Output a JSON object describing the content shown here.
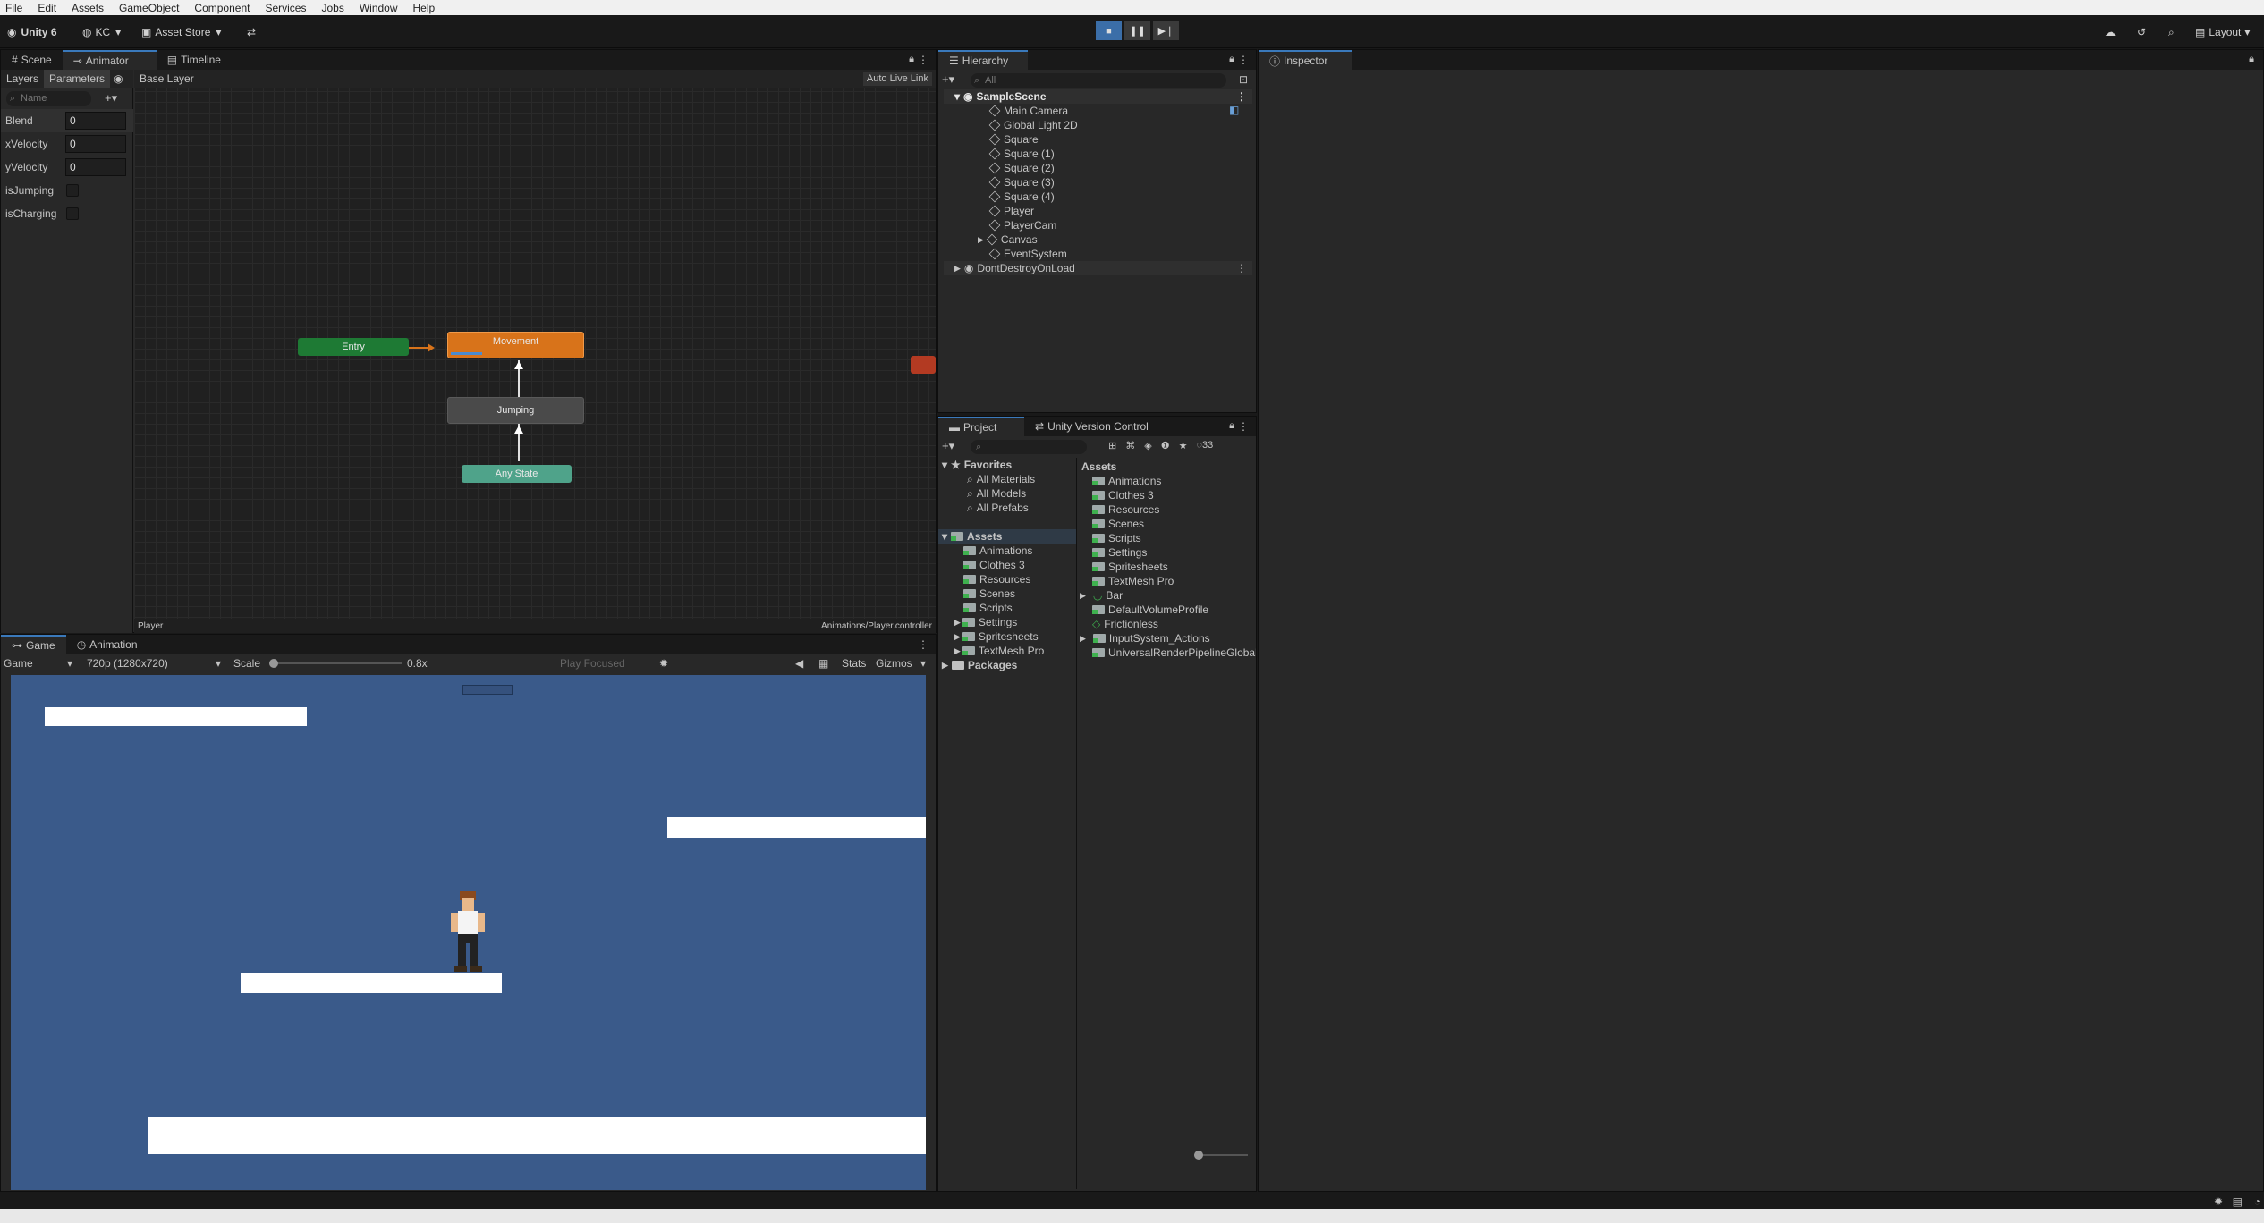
{
  "menu": [
    "File",
    "Edit",
    "Assets",
    "GameObject",
    "Component",
    "Services",
    "Jobs",
    "Window",
    "Help"
  ],
  "toolbar": {
    "unity": "Unity 6",
    "account": "KC",
    "asset_store": "Asset Store",
    "layout": "Layout"
  },
  "scene_tabs": {
    "scene": "Scene",
    "animator": "Animator",
    "timeline": "Timeline"
  },
  "animator": {
    "layers_tab": "Layers",
    "parameters_tab": "Parameters",
    "base_layer": "Base Layer",
    "auto_live_link": "Auto Live Link",
    "search_placeholder": "Name",
    "parameters": [
      {
        "name": "Blend",
        "value": "0"
      },
      {
        "name": "xVelocity",
        "value": "0"
      },
      {
        "name": "yVelocity",
        "value": "0"
      },
      {
        "name": "isJumping"
      },
      {
        "name": "isCharging"
      }
    ],
    "states": {
      "entry": "Entry",
      "movement": "Movement",
      "jumping": "Jumping",
      "any_state": "Any State"
    },
    "footer_left": "Player",
    "footer_right": "Animations/Player.controller"
  },
  "game_tabs": {
    "game": "Game",
    "animation": "Animation"
  },
  "game_bar": {
    "display": "Game",
    "resolution": "720p (1280x720)",
    "scale_label": "Scale",
    "scale_value": "0.8x",
    "play_focused": "Play Focused",
    "stats": "Stats",
    "gizmos": "Gizmos"
  },
  "game_view": {
    "background": "#3a5a8a"
  },
  "hierarchy": {
    "tab": "Hierarchy",
    "search_placeholder": "All",
    "scene": "SampleScene",
    "items": [
      "Main Camera",
      "Global Light 2D",
      "Square",
      "Square (1)",
      "Square (2)",
      "Square (3)",
      "Square (4)",
      "Player",
      "PlayerCam",
      "Canvas",
      "EventSystem"
    ],
    "ddol": "DontDestroyOnLoad"
  },
  "project": {
    "tab": "Project",
    "vc_tab": "Unity Version Control",
    "count": "33",
    "favorites": "Favorites",
    "fav_items": [
      "All Materials",
      "All Models",
      "All Prefabs"
    ],
    "assets": "Assets",
    "asset_folders": [
      "Animations",
      "Clothes 3",
      "Resources",
      "Scenes",
      "Scripts",
      "Settings",
      "Spritesheets",
      "TextMesh Pro"
    ],
    "packages": "Packages",
    "right_header": "Assets",
    "right_items": [
      "Animations",
      "Clothes 3",
      "Resources",
      "Scenes",
      "Scripts",
      "Settings",
      "Spritesheets",
      "TextMesh Pro",
      "Bar",
      "DefaultVolumeProfile",
      "Frictionless",
      "InputSystem_Actions",
      "UniversalRenderPipelineGlobalSettings"
    ]
  },
  "inspector": {
    "tab": "Inspector"
  },
  "colors": {
    "accent": "#3a79bb",
    "entry": "#1e7a34",
    "movement": "#d8731a",
    "any_state": "#4fa38a",
    "game_bg": "#3a5a8a"
  }
}
